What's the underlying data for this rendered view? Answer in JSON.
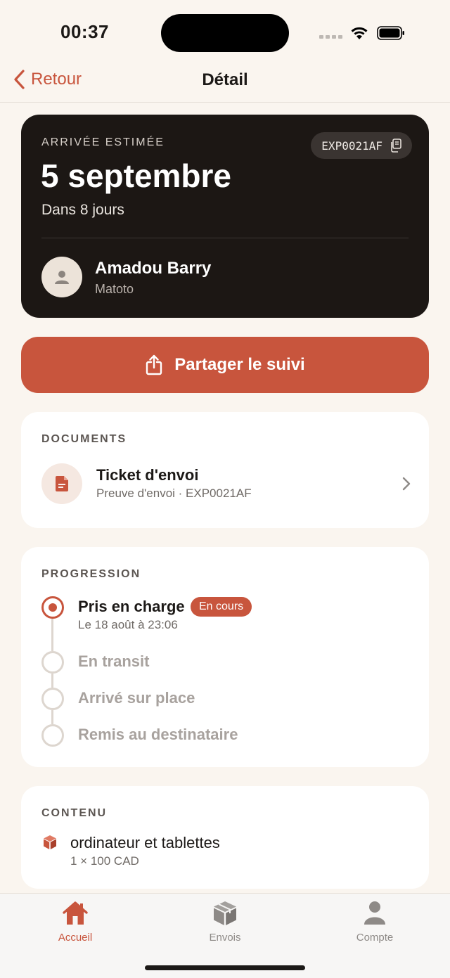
{
  "status_bar": {
    "time": "00:37"
  },
  "nav": {
    "back_label": "Retour",
    "title": "Détail"
  },
  "hero": {
    "label": "ARRIVÉE ESTIMÉE",
    "date": "5 septembre",
    "subtitle": "Dans 8 jours",
    "tracking_code": "EXP0021AF",
    "recipient_name": "Amadou Barry",
    "recipient_place": "Matoto"
  },
  "share_button": {
    "label": "Partager le suivi"
  },
  "documents": {
    "label": "DOCUMENTS",
    "items": [
      {
        "title": "Ticket d'envoi",
        "subtitle": "Preuve d'envoi · EXP0021AF"
      }
    ]
  },
  "progression": {
    "label": "PROGRESSION",
    "steps": [
      {
        "title": "Pris en charge",
        "badge": "En cours",
        "date": "Le 18 août à 23:06",
        "state": "active"
      },
      {
        "title": "En transit",
        "state": "pending"
      },
      {
        "title": "Arrivé sur place",
        "state": "pending"
      },
      {
        "title": "Remis au destinataire",
        "state": "pending"
      }
    ]
  },
  "contents": {
    "label": "CONTENU",
    "items": [
      {
        "name": "ordinateur et tablettes",
        "quantity": "1 × 100 CAD"
      }
    ]
  },
  "tabbar": {
    "tabs": [
      {
        "label": "Accueil",
        "icon": "house-icon",
        "active": true
      },
      {
        "label": "Envois",
        "icon": "package-icon",
        "active": false
      },
      {
        "label": "Compte",
        "icon": "person-icon",
        "active": false
      }
    ]
  },
  "colors": {
    "accent": "#c8553d",
    "hero_bg": "#1c1714",
    "page_bg": "#faf5ef"
  }
}
